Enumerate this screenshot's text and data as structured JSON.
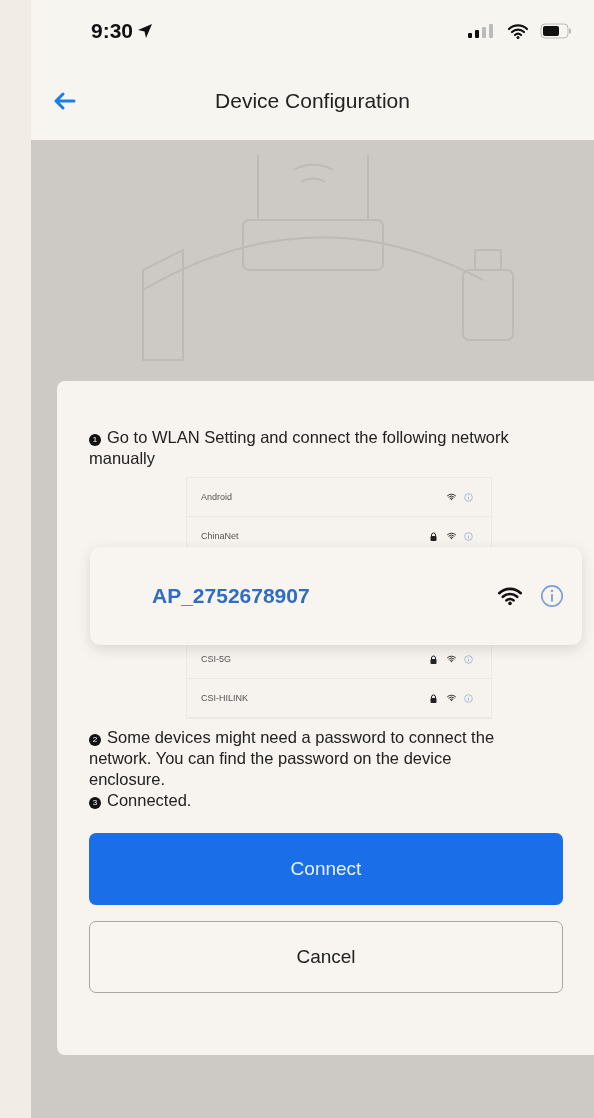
{
  "status_bar": {
    "time": "9:30"
  },
  "nav": {
    "title": "Device Configuration"
  },
  "steps": [
    {
      "number": "1",
      "text": "Go to WLAN Setting and connect the following network manually"
    },
    {
      "number": "2",
      "text": "Some devices might need a password to connect the network. You can find the password on the device enclosure."
    },
    {
      "number": "3",
      "text": "Connected."
    }
  ],
  "network_list": {
    "networks": [
      {
        "name": "Android",
        "locked": false
      },
      {
        "name": "ChinaNet",
        "locked": true
      },
      {
        "name": "CSI-5G",
        "locked": true
      },
      {
        "name": "CSI-HILINK",
        "locked": true
      }
    ],
    "highlighted": {
      "name": "AP_2752678907"
    }
  },
  "buttons": [
    {
      "label": "Connect",
      "kind": "primary"
    },
    {
      "label": "Cancel",
      "kind": "secondary"
    }
  ]
}
